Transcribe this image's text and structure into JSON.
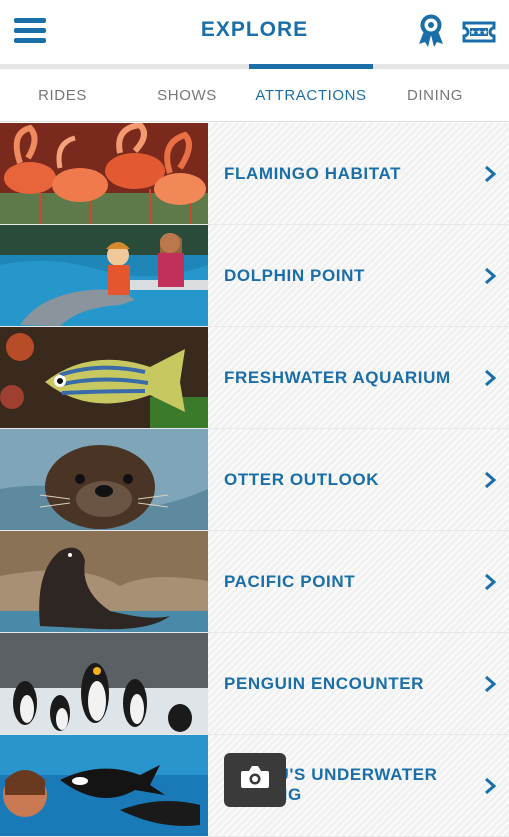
{
  "header": {
    "title": "EXPLORE",
    "icons": {
      "menu": "menu-icon",
      "award": "award-ribbon-icon",
      "tickets": "ticket-icon"
    }
  },
  "tabs": [
    {
      "label": "RIDES",
      "active": false
    },
    {
      "label": "SHOWS",
      "active": false
    },
    {
      "label": "ATTRACTIONS",
      "active": true
    },
    {
      "label": "DINING",
      "active": false
    }
  ],
  "attractions": [
    {
      "name": "FLAMINGO HABITAT",
      "photo": "flamingos"
    },
    {
      "name": "DOLPHIN POINT",
      "photo": "children with dolphin"
    },
    {
      "name": "FRESHWATER AQUARIUM",
      "photo": "striped fish"
    },
    {
      "name": "OTTER OUTLOOK",
      "photo": "sea otter"
    },
    {
      "name": "PACIFIC POINT",
      "photo": "sea lion on rocks"
    },
    {
      "name": "PENGUIN ENCOUNTER",
      "photo": "penguins"
    },
    {
      "name": "SHAMU'S UNDERWATER VIEWING",
      "line1": "SHAMU'S UNDERWATER",
      "line2": "VIEWING",
      "photo": "orcas underwater"
    }
  ],
  "floating_button": {
    "icon": "camera-icon"
  },
  "colors": {
    "brand": "#1a6fa8",
    "tab_inactive": "#777777",
    "row_bg": "#f6f6f6"
  }
}
